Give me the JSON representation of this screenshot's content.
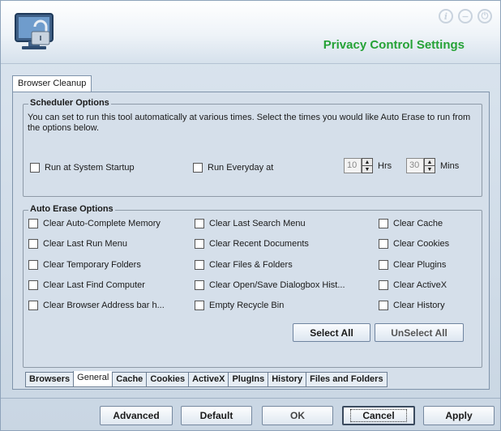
{
  "header": {
    "title": "Privacy Control Settings",
    "icons": [
      "info-icon",
      "minimize-icon",
      "power-icon"
    ],
    "info_glyph": "i",
    "minimize_glyph": "−",
    "power_glyph": "⏻"
  },
  "outer_tab": {
    "label": "Browser Cleanup"
  },
  "scheduler": {
    "title": "Scheduler Options",
    "description": "You can set to run this tool automatically at various times. Select the times you would like Auto Erase to run from the options below.",
    "run_startup_label": "Run at System Startup",
    "run_everyday_label": "Run Everyday at",
    "hours_value": "10",
    "hours_label": "Hrs",
    "mins_value": "30",
    "mins_label": "Mins"
  },
  "auto_erase": {
    "title": "Auto Erase Options",
    "col1": [
      "Clear Auto-Complete Memory",
      "Clear Last Run Menu",
      "Clear Temporary Folders",
      "Clear Last Find Computer",
      "Clear Browser Address bar h..."
    ],
    "col2": [
      "Clear Last Search Menu",
      "Clear Recent Documents",
      "Clear Files & Folders",
      "Clear Open/Save Dialogbox Hist...",
      "Empty Recycle Bin"
    ],
    "col3": [
      "Clear Cache",
      "Clear Cookies",
      "Clear Plugins",
      "Clear ActiveX",
      "Clear History"
    ],
    "select_all": "Select All",
    "unselect_all": "UnSelect All"
  },
  "bottom_tabs": [
    "Browsers",
    "General",
    "Cache",
    "Cookies",
    "ActiveX",
    "PlugIns",
    "History",
    "Files and Folders"
  ],
  "active_bottom_tab": "General",
  "footer": {
    "advanced": "Advanced",
    "default": "Default",
    "ok": "OK",
    "cancel": "Cancel",
    "apply": "Apply"
  },
  "colors": {
    "title_green": "#25a236",
    "background": "#d5dfea"
  }
}
